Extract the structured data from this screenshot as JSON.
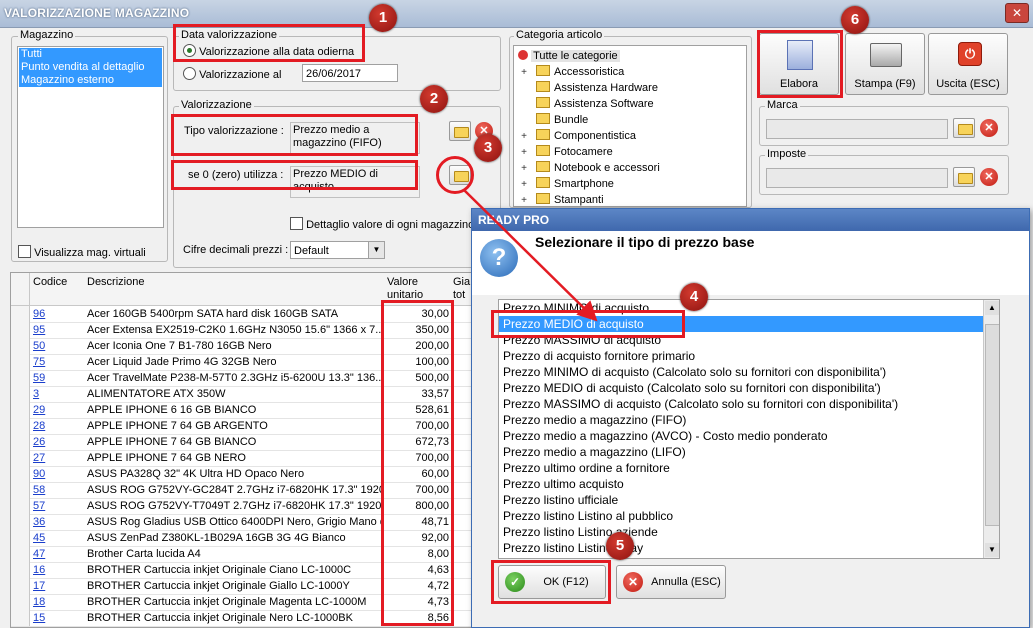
{
  "window": {
    "title": "VALORIZZAZIONE MAGAZZINO",
    "close": "✕"
  },
  "magazzino": {
    "label": "Magazzino",
    "items": [
      "Tutti",
      "Punto vendita al dettaglio",
      "Magazzino esterno"
    ],
    "virtual_label": "Visualizza mag. virtuali"
  },
  "data_val": {
    "label": "Data valorizzazione",
    "option_today": "Valorizzazione alla data odierna",
    "option_date": "Valorizzazione al",
    "date_value": "26/06/2017"
  },
  "valorizzazione": {
    "label": "Valorizzazione",
    "tipo_label": "Tipo valorizzazione :",
    "tipo_value": "Prezzo medio a magazzino (FIFO)",
    "zero_label": "se 0 (zero) utilizza :",
    "zero_value": "Prezzo MEDIO di acquisto",
    "dettaglio_label": "Dettaglio valore di ogni magazzino",
    "cifre_label": "Cifre decimali prezzi :",
    "cifre_value": "Default"
  },
  "categoria": {
    "label": "Categoria articolo",
    "root": "Tutte le categorie",
    "items": [
      {
        "label": "Accessoristica",
        "expandable": true
      },
      {
        "label": "Assistenza Hardware",
        "expandable": false
      },
      {
        "label": "Assistenza Software",
        "expandable": false
      },
      {
        "label": "Bundle",
        "expandable": false
      },
      {
        "label": "Componentistica",
        "expandable": true
      },
      {
        "label": "Fotocamere",
        "expandable": true
      },
      {
        "label": "Notebook e accessori",
        "expandable": true
      },
      {
        "label": "Smartphone",
        "expandable": true
      },
      {
        "label": "Stampanti",
        "expandable": true
      }
    ]
  },
  "toolbar": {
    "elabora": "Elabora",
    "stampa": "Stampa (F9)",
    "uscita": "Uscita (ESC)"
  },
  "marca": {
    "label": "Marca"
  },
  "imposte": {
    "label": "Imposte"
  },
  "table": {
    "headers": {
      "codice": "Codice",
      "descrizione": "Descrizione",
      "valore1": "Valore",
      "valore2": "unitario",
      "gia1": "Gia",
      "gia2": "tot"
    },
    "rows": [
      {
        "code": "96",
        "desc": "Acer 160GB 5400rpm SATA hard disk 160GB SATA",
        "val": "30,00"
      },
      {
        "code": "95",
        "desc": "Acer Extensa EX2519-C2K0 1.6GHz N3050 15.6\" 1366 x 7...",
        "val": "350,00"
      },
      {
        "code": "50",
        "desc": "Acer Iconia One 7 B1-780 16GB Nero",
        "val": "200,00"
      },
      {
        "code": "75",
        "desc": "Acer Liquid Jade Primo 4G 32GB Nero",
        "val": "100,00"
      },
      {
        "code": "59",
        "desc": "Acer TravelMate P238-M-57T0 2.3GHz i5-6200U 13.3\" 136...",
        "val": "500,00"
      },
      {
        "code": "3",
        "desc": "ALIMENTATORE ATX 350W",
        "val": "33,57"
      },
      {
        "code": "29",
        "desc": "APPLE IPHONE 6 16 GB BIANCO",
        "val": "528,61"
      },
      {
        "code": "28",
        "desc": "APPLE IPHONE 7 64 GB ARGENTO",
        "val": "700,00"
      },
      {
        "code": "26",
        "desc": "APPLE IPHONE 7 64 GB BIANCO",
        "val": "672,73"
      },
      {
        "code": "27",
        "desc": "APPLE IPHONE 7 64 GB NERO",
        "val": "700,00"
      },
      {
        "code": "90",
        "desc": "ASUS PA328Q 32\" 4K Ultra HD Opaco Nero",
        "val": "60,00"
      },
      {
        "code": "58",
        "desc": "ASUS ROG G752VY-GC284T 2.7GHz i7-6820HK 17.3\" 1920 ...",
        "val": "700,00"
      },
      {
        "code": "57",
        "desc": "ASUS ROG G752VY-T7049T 2.7GHz i7-6820HK 17.3\" 1920 ...",
        "val": "800,00"
      },
      {
        "code": "36",
        "desc": "ASUS Rog Gladius USB Ottico 6400DPI Nero, Grigio Mano d...",
        "val": "48,71"
      },
      {
        "code": "45",
        "desc": "ASUS ZenPad Z380KL-1B029A 16GB 3G 4G Bianco",
        "val": "92,00"
      },
      {
        "code": "47",
        "desc": "Brother Carta lucida A4",
        "val": "8,00"
      },
      {
        "code": "16",
        "desc": "BROTHER Cartuccia inkjet Originale Ciano LC-1000C",
        "val": "4,63"
      },
      {
        "code": "17",
        "desc": "BROTHER Cartuccia inkjet Originale Giallo LC-1000Y",
        "val": "4,72"
      },
      {
        "code": "18",
        "desc": "BROTHER Cartuccia inkjet Originale Magenta LC-1000M",
        "val": "4,73"
      },
      {
        "code": "15",
        "desc": "BROTHER Cartuccia inkjet Originale Nero LC-1000BK",
        "val": "8,56"
      }
    ]
  },
  "dialog": {
    "title": "READY PRO",
    "message": "Selezionare il tipo di prezzo base",
    "options": [
      "Prezzo MINIMO di acquisto",
      "Prezzo MEDIO di acquisto",
      "Prezzo MASSIMO di acquisto",
      "Prezzo di acquisto fornitore primario",
      "Prezzo MINIMO di acquisto (Calcolato solo su fornitori con disponibilita')",
      "Prezzo MEDIO di acquisto (Calcolato solo su fornitori con disponibilita')",
      "Prezzo MASSIMO di acquisto (Calcolato solo su fornitori con disponibilita')",
      "Prezzo medio a magazzino (FIFO)",
      "Prezzo medio a magazzino (AVCO) - Costo medio ponderato",
      "Prezzo medio a magazzino (LIFO)",
      "Prezzo ultimo ordine a fornitore",
      "Prezzo ultimo acquisto",
      "Prezzo listino ufficiale",
      "Prezzo listino Listino al pubblico",
      "Prezzo listino Listino aziende",
      "Prezzo listino Listino eBay"
    ],
    "selected_index": 1,
    "ok": "OK (F12)",
    "cancel": "Annulla (ESC)"
  },
  "markers": [
    "1",
    "2",
    "3",
    "4",
    "5",
    "6"
  ],
  "colors": {
    "highlight": "#e31b23",
    "selection": "#3399ff",
    "link": "#1a3ecc"
  }
}
